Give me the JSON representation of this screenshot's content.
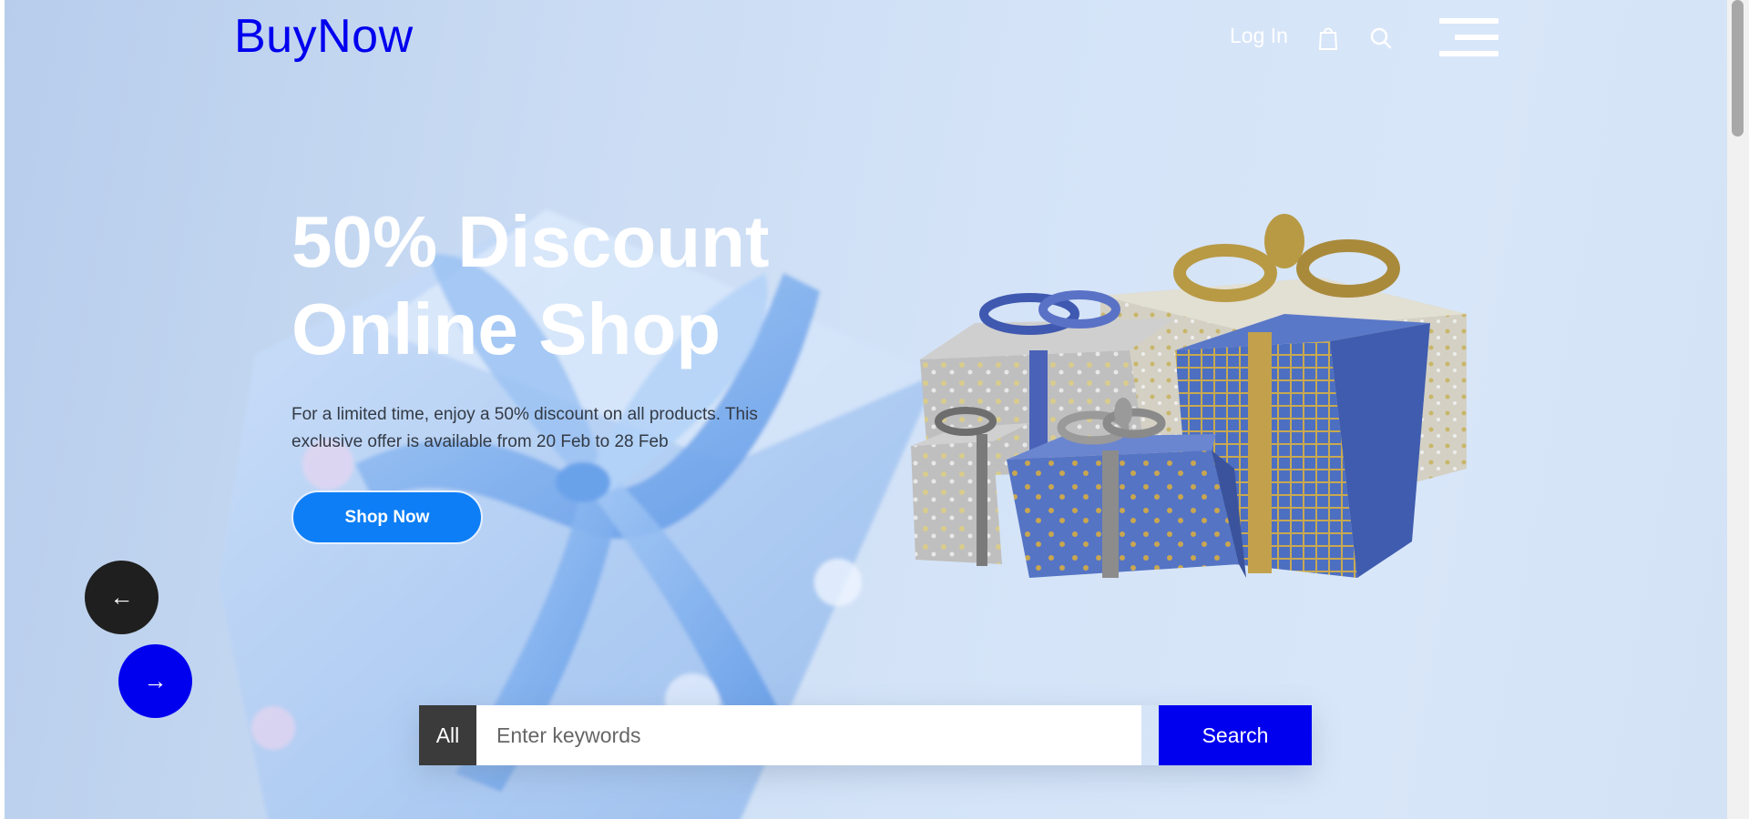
{
  "header": {
    "logo": "BuyNow",
    "login_label": "Log In",
    "bag_icon": "shopping-bag-icon",
    "search_icon": "search-icon",
    "menu_icon": "hamburger-menu-icon"
  },
  "hero": {
    "headline_line1": "50% Discount",
    "headline_line2": "Online Shop",
    "description": "For a limited time, enjoy a 50% discount on all products. This exclusive offer is available from 20 Feb to 28 Feb",
    "cta_label": "Shop Now",
    "prev_arrow": "←",
    "next_arrow": "→"
  },
  "search": {
    "category_label": "All",
    "placeholder": "Enter keywords",
    "button_label": "Search"
  },
  "colors": {
    "brand": "#0000ee",
    "cta": "#0d7ef5",
    "dark": "#1f1f1f"
  }
}
